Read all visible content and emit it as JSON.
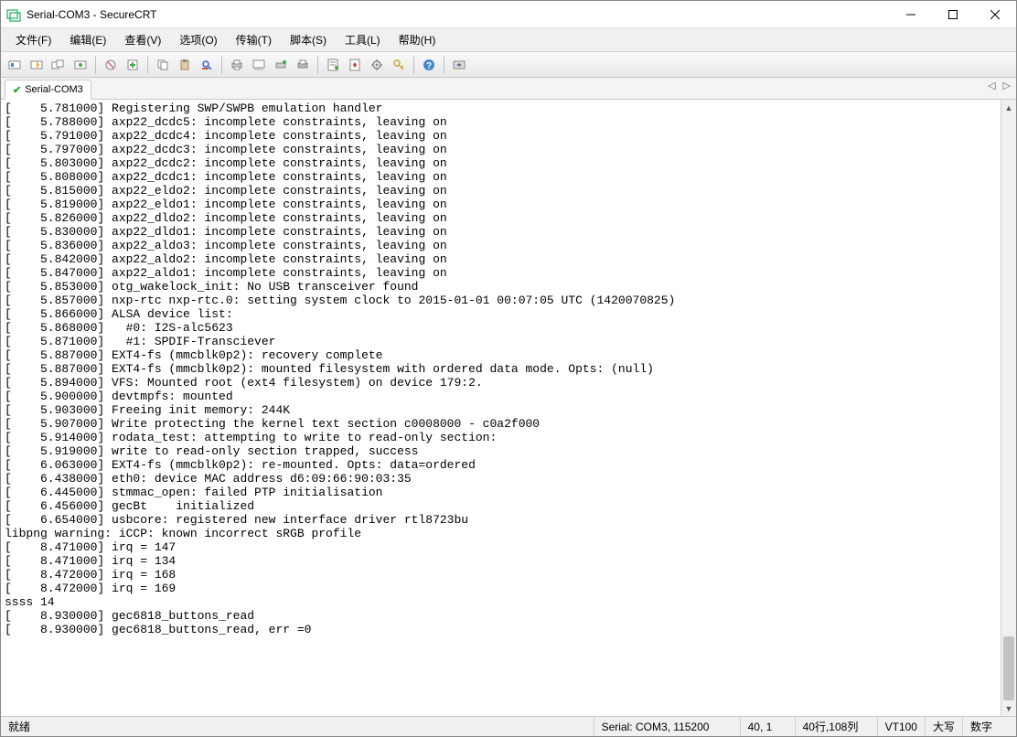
{
  "titlebar": {
    "title": "Serial-COM3 - SecureCRT"
  },
  "menus": [
    {
      "label": "文件(F)"
    },
    {
      "label": "编辑(E)"
    },
    {
      "label": "查看(V)"
    },
    {
      "label": "选项(O)"
    },
    {
      "label": "传输(T)"
    },
    {
      "label": "脚本(S)"
    },
    {
      "label": "工具(L)"
    },
    {
      "label": "帮助(H)"
    }
  ],
  "tabs": [
    {
      "label": "Serial-COM3"
    }
  ],
  "terminal_lines": [
    "[    5.781000] Registering SWP/SWPB emulation handler",
    "[    5.788000] axp22_dcdc5: incomplete constraints, leaving on",
    "[    5.791000] axp22_dcdc4: incomplete constraints, leaving on",
    "[    5.797000] axp22_dcdc3: incomplete constraints, leaving on",
    "[    5.803000] axp22_dcdc2: incomplete constraints, leaving on",
    "[    5.808000] axp22_dcdc1: incomplete constraints, leaving on",
    "[    5.815000] axp22_eldo2: incomplete constraints, leaving on",
    "[    5.819000] axp22_eldo1: incomplete constraints, leaving on",
    "[    5.826000] axp22_dldo2: incomplete constraints, leaving on",
    "[    5.830000] axp22_dldo1: incomplete constraints, leaving on",
    "[    5.836000] axp22_aldo3: incomplete constraints, leaving on",
    "[    5.842000] axp22_aldo2: incomplete constraints, leaving on",
    "[    5.847000] axp22_aldo1: incomplete constraints, leaving on",
    "[    5.853000] otg_wakelock_init: No USB transceiver found",
    "[    5.857000] nxp-rtc nxp-rtc.0: setting system clock to 2015-01-01 00:07:05 UTC (1420070825)",
    "[    5.866000] ALSA device list:",
    "[    5.868000]   #0: I2S-alc5623",
    "[    5.871000]   #1: SPDIF-Transciever",
    "[    5.887000] EXT4-fs (mmcblk0p2): recovery complete",
    "[    5.887000] EXT4-fs (mmcblk0p2): mounted filesystem with ordered data mode. Opts: (null)",
    "[    5.894000] VFS: Mounted root (ext4 filesystem) on device 179:2.",
    "[    5.900000] devtmpfs: mounted",
    "[    5.903000] Freeing init memory: 244K",
    "[    5.907000] Write protecting the kernel text section c0008000 - c0a2f000",
    "[    5.914000] rodata_test: attempting to write to read-only section:",
    "[    5.919000] write to read-only section trapped, success",
    "[    6.063000] EXT4-fs (mmcblk0p2): re-mounted. Opts: data=ordered",
    "[    6.438000] eth0: device MAC address d6:09:66:90:03:35",
    "[    6.445000] stmmac_open: failed PTP initialisation",
    "[    6.456000] gecBt    initialized",
    "[    6.654000] usbcore: registered new interface driver rtl8723bu",
    "libpng warning: iCCP: known incorrect sRGB profile",
    "[    8.471000] irq = 147",
    "[    8.471000] irq = 134",
    "[    8.472000] irq = 168",
    "[    8.472000] irq = 169",
    "ssss 14",
    "[    8.930000] gec6818_buttons_read",
    "[    8.930000] gec6818_buttons_read, err =0"
  ],
  "status": {
    "ready": "就绪",
    "conn": "Serial: COM3, 115200",
    "cursor": "40,  1",
    "size": "40行,108列",
    "emul": "VT100",
    "caps": "大写",
    "num": "数字"
  }
}
